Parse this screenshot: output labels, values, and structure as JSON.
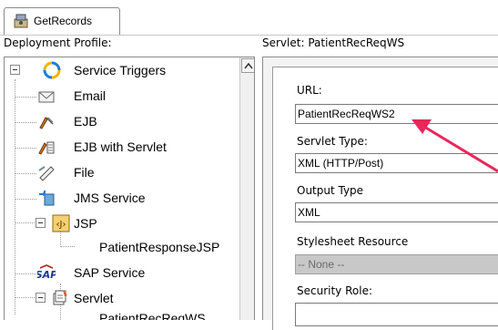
{
  "tab": {
    "label": "GetRecords"
  },
  "left_header": "Deployment Profile:",
  "right_header": "Servlet: PatientRecReqWS",
  "tree": {
    "root": "Service Triggers",
    "items": [
      {
        "label": "Email",
        "icon": "envelope-icon"
      },
      {
        "label": "EJB",
        "icon": "ejb-icon"
      },
      {
        "label": "EJB with Servlet",
        "icon": "ejb-servlet-icon"
      },
      {
        "label": "File",
        "icon": "file-icon"
      },
      {
        "label": "JMS Service",
        "icon": "jms-icon"
      },
      {
        "label": "JSP",
        "icon": "jsp-icon"
      },
      {
        "label": "PatientResponseJSP",
        "icon": ""
      },
      {
        "label": "SAP Service",
        "icon": "sap-icon"
      },
      {
        "label": "Servlet",
        "icon": "servlet-icon"
      },
      {
        "label": "PatientRecReqWS",
        "icon": ""
      }
    ]
  },
  "form": {
    "url_label": "URL:",
    "url_value": "PatientRecReqWS2",
    "servlet_type_label": "Servlet Type:",
    "servlet_type_value": "XML (HTTP/Post)",
    "output_type_label": "Output Type",
    "output_type_value": "XML",
    "stylesheet_label": "Stylesheet Resource",
    "stylesheet_value": "-- None --",
    "security_role_label": "Security Role:",
    "security_role_value": ""
  },
  "colors": {
    "annotation_arrow": "#e8275a"
  }
}
